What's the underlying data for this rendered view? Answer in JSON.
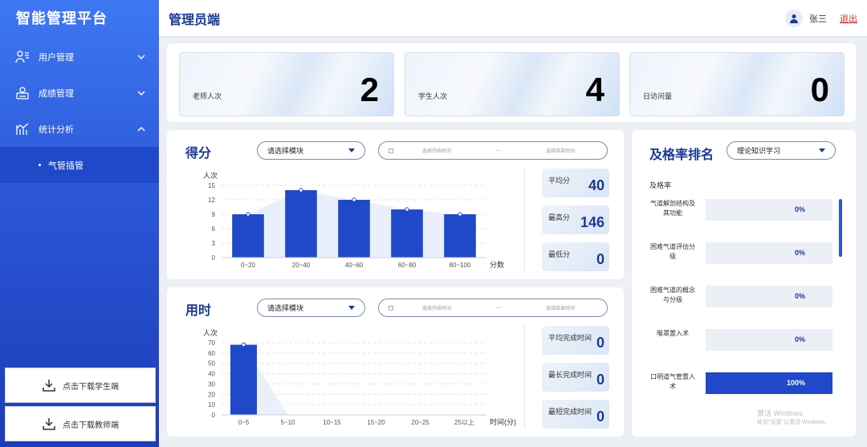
{
  "app": {
    "title": "智能管理平台"
  },
  "sidebar": {
    "items": [
      {
        "label": "用户管理",
        "icon": "user-list-icon"
      },
      {
        "label": "成绩管理",
        "icon": "grade-icon"
      },
      {
        "label": "统计分析",
        "icon": "chart-icon"
      }
    ],
    "sub_items": [
      {
        "label": "气管插管"
      }
    ],
    "download_student": "点击下载学生端",
    "download_teacher": "点击下载教师端"
  },
  "header": {
    "title": "管理员端",
    "user_name": "张三",
    "logout": "退出"
  },
  "stats": [
    {
      "label": "老师人次",
      "value": "2"
    },
    {
      "label": "学生人次",
      "value": "4"
    },
    {
      "label": "日访问量",
      "value": "0"
    }
  ],
  "score_panel": {
    "title": "得分",
    "select": "请选择模块",
    "range_start": "选择开始时间",
    "range_sep": "—",
    "range_end": "选择结束时间",
    "summary": [
      {
        "label": "平均分",
        "value": "40"
      },
      {
        "label": "最高分",
        "value": "146"
      },
      {
        "label": "最低分",
        "value": "0"
      }
    ]
  },
  "time_panel": {
    "title": "用时",
    "select": "请选择模块",
    "range_start": "选择开始时间",
    "range_sep": "—",
    "range_end": "选择结束时间",
    "summary": [
      {
        "label": "平均完成时间",
        "value": "0"
      },
      {
        "label": "最长完成时间",
        "value": "0"
      },
      {
        "label": "最短完成时间",
        "value": "0"
      }
    ]
  },
  "rank_panel": {
    "title": "及格率排名",
    "select": "理论知识学习",
    "column_label": "及格率",
    "items": [
      {
        "name": "气道解剖结构及其功能",
        "rate": 0,
        "label": "0%"
      },
      {
        "name": "困难气道评估分级",
        "rate": 0,
        "label": "0%"
      },
      {
        "name": "困难气道的概念与分级",
        "rate": 0,
        "label": "0%"
      },
      {
        "name": "喉罩置入术",
        "rate": 0,
        "label": "0%"
      },
      {
        "name": "口明道气管置入术",
        "rate": 1,
        "label": "100%"
      }
    ]
  },
  "watermark": {
    "line1": "激活 Windows",
    "line2": "转到\"设置\"以激活 Windows。"
  },
  "chart_data": [
    {
      "type": "bar",
      "ylabel": "人次",
      "xlabel": "分数",
      "categories": [
        "0~20",
        "20~40",
        "40~60",
        "60~80",
        "80~100"
      ],
      "values": [
        9,
        14,
        12,
        10,
        9
      ],
      "yticks": [
        0,
        3,
        6,
        9,
        12,
        15
      ],
      "ylim": [
        0,
        15
      ],
      "grid": true,
      "color": "#1f49c8"
    },
    {
      "type": "bar",
      "ylabel": "人次",
      "xlabel": "时间(分)",
      "categories": [
        "0~5",
        "5~10",
        "10~15",
        "15~20",
        "20~25",
        "25以上"
      ],
      "values": [
        68,
        0,
        0,
        0,
        0,
        0
      ],
      "yticks": [
        0,
        10,
        20,
        30,
        40,
        50,
        60,
        70
      ],
      "ylim": [
        0,
        70
      ],
      "grid": true,
      "color": "#1f49c8"
    }
  ]
}
